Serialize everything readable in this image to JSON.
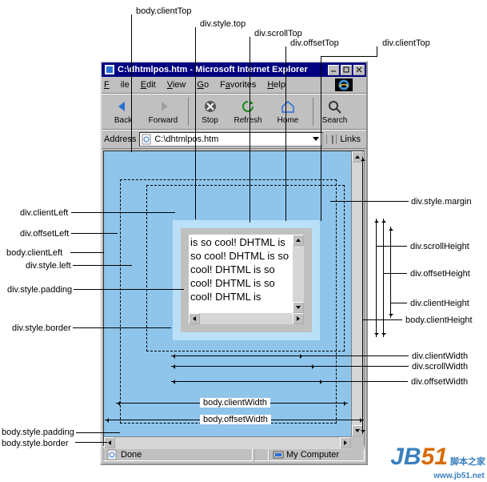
{
  "top_labels": {
    "body_clientTop": "body.clientTop",
    "div_style_top": "div.style.top",
    "div_scrollTop": "div.scrollTop",
    "div_offsetTop": "div.offsetTop",
    "div_clientTop": "div.clientTop"
  },
  "left_labels": {
    "div_clientLeft": "div.clientLeft",
    "div_offsetLeft": "div.offsetLeft",
    "body_clientLeft": "body.clientLeft",
    "div_style_left": "div.style.left",
    "div_style_padding": "div.style.padding",
    "div_style_border": "div.style.border",
    "body_style_padding": "body.style.padding",
    "body_style_border": "body.style.border"
  },
  "right_labels": {
    "div_style_margin": "div.style.margin",
    "div_scrollHeight": "div.scrollHeight",
    "div_offsetHeight": "div.offsetHeight",
    "div_clientHeight": "div.clientHeight",
    "body_clientHeight": "body.clientHeight",
    "div_clientWidth": "div.clientWidth",
    "div_scrollWidth": "div.scrollWidth",
    "div_offsetWidth": "div.offsetWidth"
  },
  "width_measures": {
    "body_clientWidth": "body.clientWidth",
    "body_offsetWidth": "body.offsetWidth"
  },
  "ie": {
    "title": "C:\\dhtmlpos.htm - Microsoft Internet Explorer",
    "menu": {
      "file": "File",
      "edit": "Edit",
      "view": "View",
      "go": "Go",
      "favorites": "Favorites",
      "help": "Help"
    },
    "toolbar": {
      "back": "Back",
      "forward": "Forward",
      "stop": "Stop",
      "refresh": "Refresh",
      "home": "Home",
      "search": "Search"
    },
    "address_label": "Address",
    "address_value": "C:\\dhtmlpos.htm",
    "links_label": "Links",
    "status_done": "Done",
    "status_zone": "My Computer"
  },
  "div_text": "is so cool! DHTML is so cool! DHTML is so cool! DHTML is so cool! DHTML is so cool! DHTML is",
  "watermark": {
    "brand_prefix": "JB",
    "brand_num": "51",
    "zh": "脚本之家",
    "url": "www.jb51.net"
  }
}
